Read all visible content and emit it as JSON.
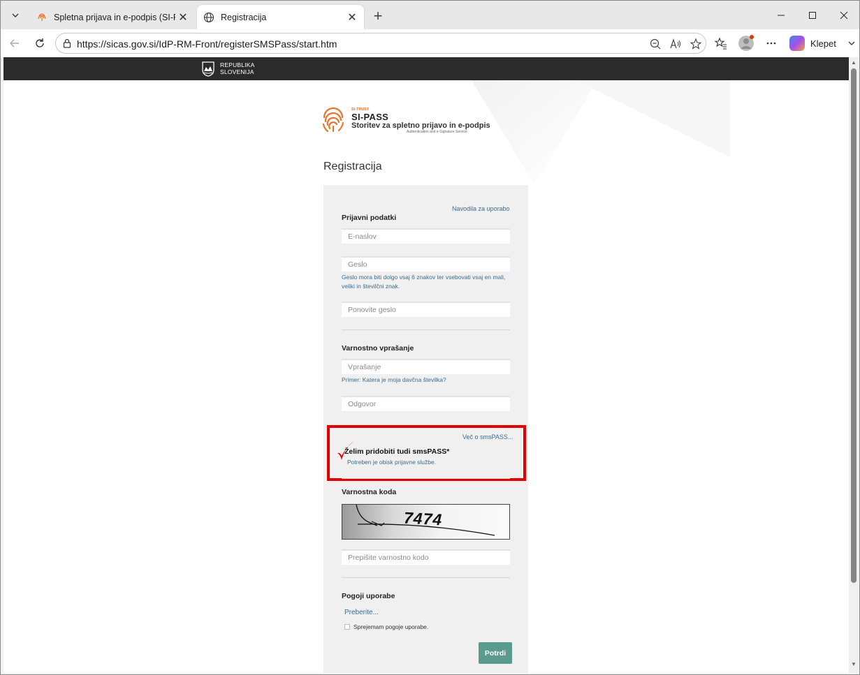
{
  "browser": {
    "tabs": [
      {
        "title": "Spletna prijava in e-podpis (SI-PAS",
        "active": false,
        "icon": "fingerprint-icon"
      },
      {
        "title": "Registracija",
        "active": true,
        "icon": "globe-icon"
      }
    ],
    "url": "https://sicas.gov.si/IdP-RM-Front/registerSMSPass/start.htm",
    "copilot_label": "Klepet"
  },
  "gov_bar": {
    "line1": "REPUBLIKA",
    "line2": "SLOVENIJA"
  },
  "logo": {
    "si_trust": "SI-TRUST",
    "brand": "SI-PASS",
    "subtitle": "Storitev za spletno prijavo in e-podpis",
    "english": "Authentication and e-Signature Service"
  },
  "page": {
    "title": "Registracija"
  },
  "form": {
    "guide_link": "Navodila za uporabo",
    "login_section": "Prijavni podatki",
    "email_placeholder": "E-naslov",
    "password_placeholder": "Geslo",
    "password_hint": "Geslo mora biti dolgo vsaj 6 znakov ter vsebovati vsaj en mali, veliki in številčni znak.",
    "repeat_password_placeholder": "Ponovite geslo",
    "security_section": "Varnostno vprašanje",
    "question_placeholder": "Vprašanje",
    "question_hint": "Primer: Katera je moja davčna številka?",
    "answer_placeholder": "Odgovor",
    "sms_more_link": "Več o smsPASS...",
    "sms_checkbox_label": "Želim pridobiti tudi smsPASS*",
    "sms_note": "Potreben je obisk prijavne službe.",
    "captcha_section": "Varnostna koda",
    "captcha_text": "7474",
    "captcha_placeholder": "Prepišite varnostno kodo",
    "terms_section": "Pogoji uporabe",
    "terms_link": "Preberite...",
    "terms_accept": "Sprejemam pogoje uporabe.",
    "submit_label": "Potrdi"
  },
  "colors": {
    "highlight_box": "#e50000",
    "submit_button": "#5b9a8e",
    "link": "#3d6a8c",
    "brand_orange": "#e9742a"
  }
}
